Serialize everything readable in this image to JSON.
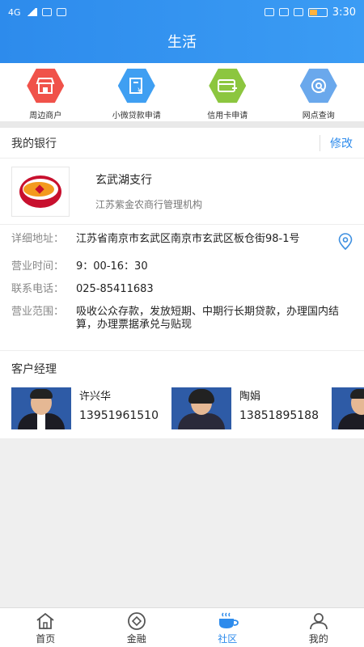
{
  "status_bar": {
    "network": "4G",
    "time": "3:30",
    "battery_percent": 45
  },
  "header": {
    "title": "生活"
  },
  "quick_links": [
    {
      "label": "周边商户",
      "icon": "shop-icon",
      "color": "#f0524a"
    },
    {
      "label": "小微贷款申请",
      "icon": "loan-icon",
      "color": "#3f9ff2"
    },
    {
      "label": "信用卡申请",
      "icon": "credit-card-icon",
      "color": "#8cc63f"
    },
    {
      "label": "网点查询",
      "icon": "branch-search-icon",
      "color": "#6aa8ec"
    }
  ],
  "my_bank": {
    "title": "我的银行",
    "edit_label": "修改",
    "bank_name": "玄武湖支行",
    "org": "江苏紫金农商行管理机构",
    "details": [
      {
        "label": "详细地址：",
        "value": "江苏省南京市玄武区南京市玄武区板仓街98-1号"
      },
      {
        "label": "营业时间：",
        "value": "9：00-16：30"
      },
      {
        "label": "联系电话：",
        "value": "025-85411683"
      },
      {
        "label": "营业范围：",
        "value": "吸收公众存款，发放短期、中期行长期贷款，办理国内结算，办理票据承兑与贴现"
      }
    ]
  },
  "managers": {
    "title": "客户经理",
    "list": [
      {
        "name": "许兴华",
        "phone": "13951961510"
      },
      {
        "name": "陶娟",
        "phone": "13851895188"
      }
    ]
  },
  "tabs": [
    {
      "label": "首页",
      "icon": "home-icon"
    },
    {
      "label": "金融",
      "icon": "finance-icon"
    },
    {
      "label": "社区",
      "icon": "coffee-icon",
      "active": true
    },
    {
      "label": "我的",
      "icon": "user-icon"
    }
  ]
}
